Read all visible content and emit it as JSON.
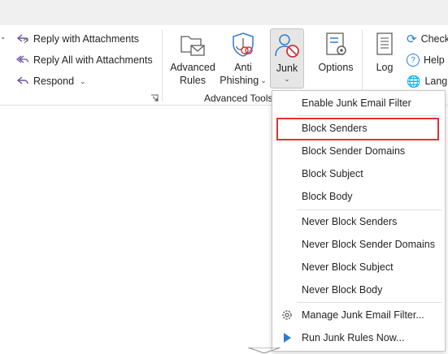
{
  "ribbon": {
    "respond_group": {
      "reply_attachments": "Reply with Attachments",
      "reply_all_attachments": "Reply All with Attachments",
      "respond": "Respond"
    },
    "advanced_tools": {
      "group_label": "Advanced Tools",
      "advanced_rules_line1": "Advanced",
      "advanced_rules_line2": "Rules",
      "anti_phishing_line1": "Anti",
      "anti_phishing_line2": "Phishing",
      "junk": "Junk",
      "options": "Options"
    },
    "right_group": {
      "log": "Log",
      "check": "Check",
      "help": "Help",
      "language": "Langu"
    }
  },
  "junk_menu": {
    "items": [
      {
        "label": "Enable Junk Email Filter"
      },
      {
        "label": "Block Senders",
        "highlighted": true
      },
      {
        "label": "Block Sender Domains"
      },
      {
        "label": "Block Subject"
      },
      {
        "label": "Block Body"
      },
      {
        "label": "Never Block Senders"
      },
      {
        "label": "Never Block Sender Domains"
      },
      {
        "label": "Never Block Subject"
      },
      {
        "label": "Never Block Body"
      },
      {
        "label": "Manage Junk Email Filter...",
        "icon": "gear-icon"
      },
      {
        "label": "Run Junk Rules Now...",
        "icon": "play-icon"
      }
    ]
  },
  "colors": {
    "highlight_border": "#e03131",
    "accent_blue": "#2b7cd3"
  }
}
